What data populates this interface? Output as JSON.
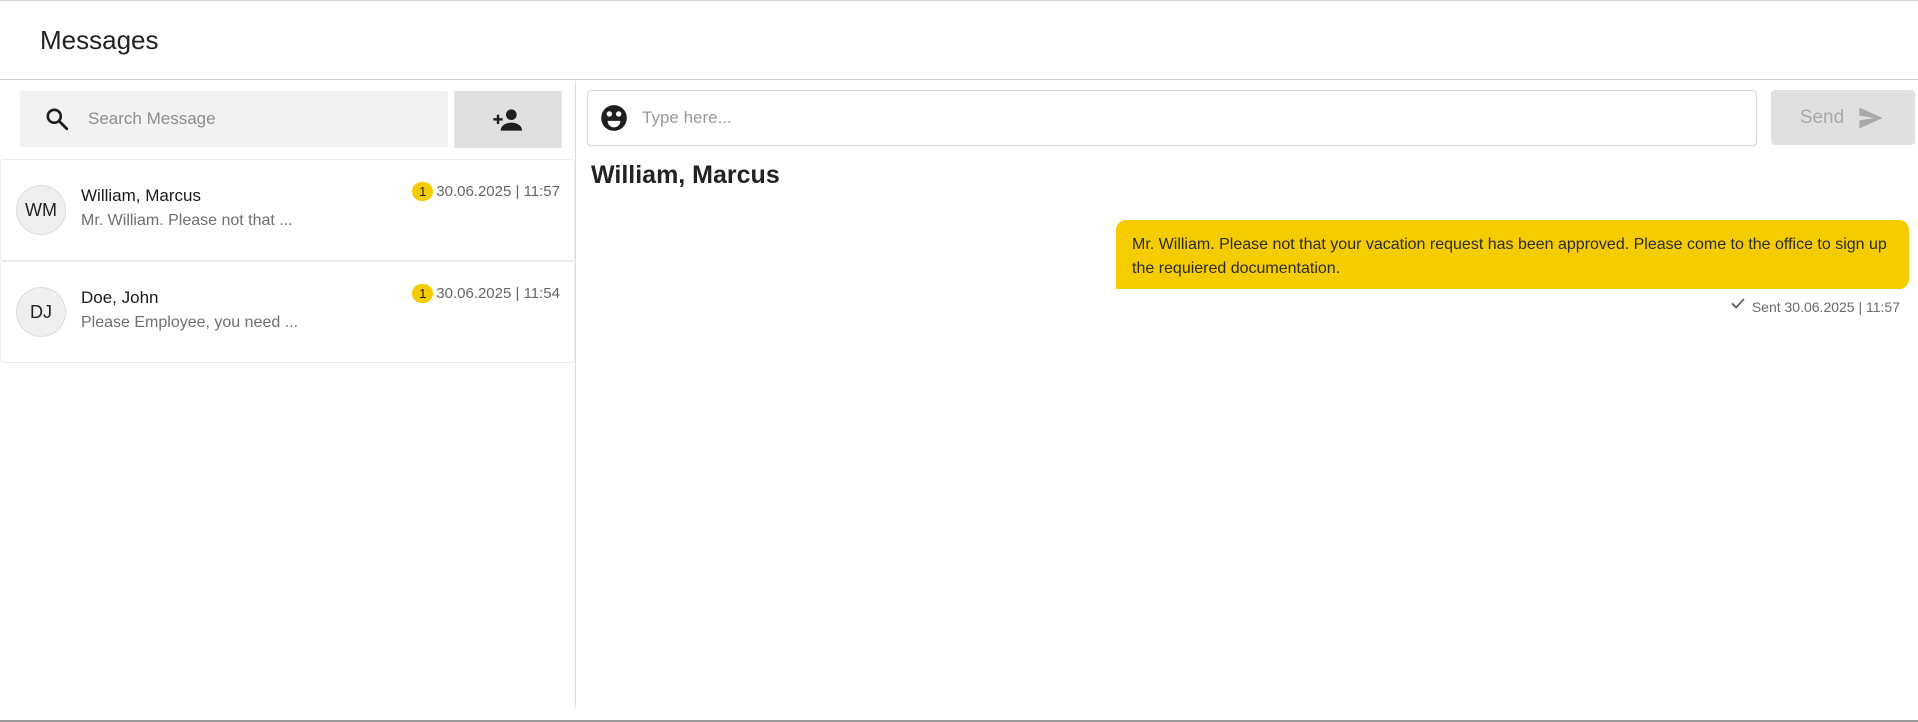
{
  "header": {
    "title": "Messages"
  },
  "search": {
    "placeholder": "Search Message",
    "value": ""
  },
  "add_user_button": {
    "icon": "person-add-icon"
  },
  "conversations": [
    {
      "initials": "WM",
      "name": "William, Marcus",
      "preview": "Mr. William. Please not that ...",
      "unread": "1",
      "timestamp": "30.06.2025 | 11:57"
    },
    {
      "initials": "DJ",
      "name": "Doe, John",
      "preview": "Please Employee, you need ...",
      "unread": "1",
      "timestamp": "30.06.2025 | 11:54"
    }
  ],
  "compose": {
    "placeholder": "Type here...",
    "value": "",
    "emoji_icon": "emoji-icon"
  },
  "send_button": {
    "label": "Send",
    "icon": "send-icon"
  },
  "chat": {
    "title": "William, Marcus",
    "messages": [
      {
        "text": "Mr. William. Please not that your vacation request has been approved. Please come to the office to sign up the requiered documentation.",
        "status": "Sent 30.06.2025 | 11:57"
      }
    ]
  },
  "colors": {
    "accent": "#f5cc00",
    "button_bg": "#e0e0e0",
    "search_bg": "#f2f2f2"
  }
}
